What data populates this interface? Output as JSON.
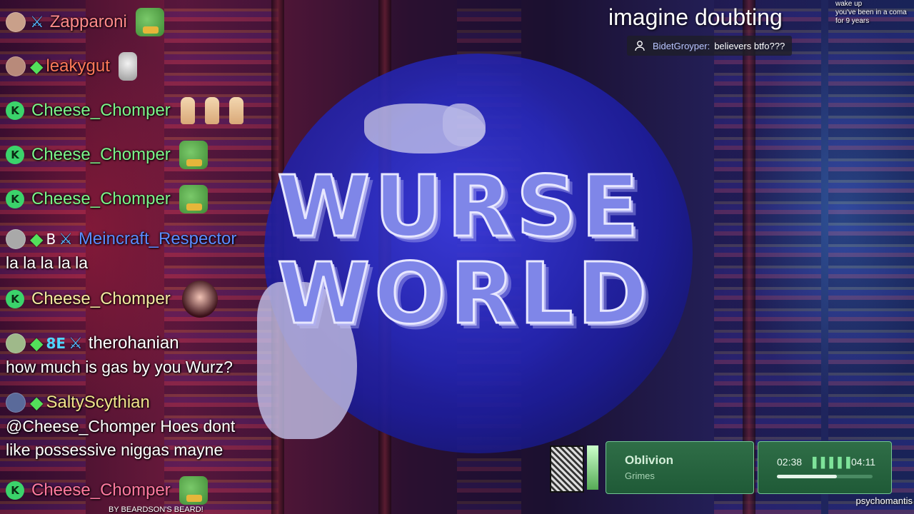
{
  "chat": {
    "messages": [
      {
        "user": "Zapparoni",
        "color": "#ff8a8a",
        "text": ""
      },
      {
        "user": "leakygut",
        "color": "#ff7a5a",
        "text": ""
      },
      {
        "user": "Cheese_Chomper",
        "color": "#7cf58a",
        "text": ""
      },
      {
        "user": "Cheese_Chomper",
        "color": "#7cf58a",
        "text": ""
      },
      {
        "user": "Cheese_Chomper",
        "color": "#7cf58a",
        "text": ""
      },
      {
        "user": "Meincraft_Respector",
        "color": "#5b8cff",
        "text": "la la la la la"
      },
      {
        "user": "Cheese_Chomper",
        "color": "#f4eaa0",
        "text": ""
      },
      {
        "user": "therohanian",
        "color": "#ffffff",
        "text": "how much is gas by you Wurz?"
      },
      {
        "user": "SaltyScythian",
        "color": "#f0e48a",
        "text": "@Cheese_Chomper Hoes dont like possessive niggas mayne"
      },
      {
        "user": "Cheese_Chomper",
        "color": "#ff7aa0",
        "text": ""
      }
    ],
    "badge_b": "B",
    "badge_8e": "8E"
  },
  "logo": {
    "line1": "WURSE",
    "line2": "WORLD"
  },
  "overlay": {
    "headline": "imagine doubting",
    "corner_note": [
      "wake up",
      "you've been in a coma",
      "for 9 years"
    ],
    "notice_user": "BidetGroyper:",
    "notice_text": "believers btfo???"
  },
  "player": {
    "title": "Oblivion",
    "artist": "Grimes",
    "current": "02:38",
    "duration": "04:11",
    "progress": 0.63
  },
  "footer": {
    "channel": "psychomantis",
    "credit": "BY BEARDSON'S BEARD!"
  }
}
